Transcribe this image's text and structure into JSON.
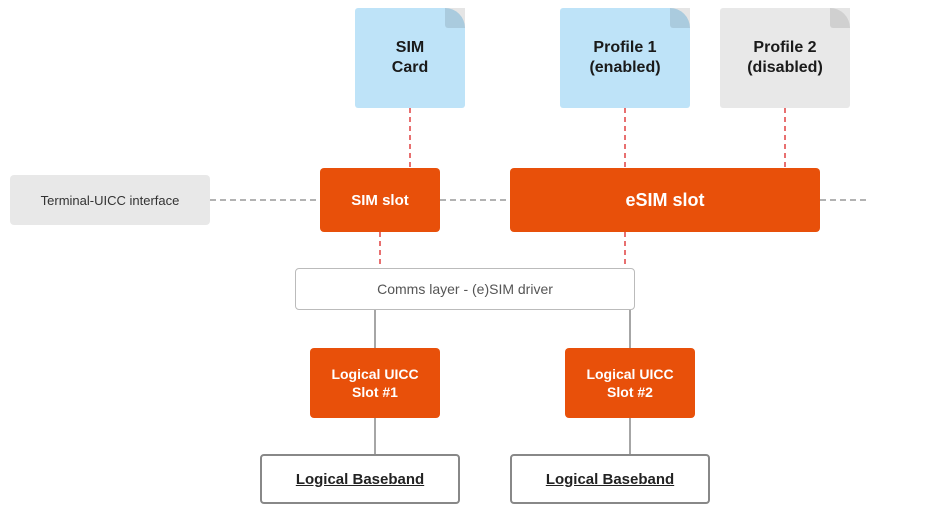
{
  "cards": {
    "sim": {
      "label": "SIM\nCard",
      "bg": "#bee3f8"
    },
    "profile1": {
      "label": "Profile 1\n(enabled)",
      "bg": "#bee3f8"
    },
    "profile2": {
      "label": "Profile 2\n(disabled)",
      "bg": "#e8e8e8"
    }
  },
  "terminal": {
    "label": "Terminal-UICC interface"
  },
  "slots": {
    "sim": "SIM slot",
    "esim": "eSIM slot"
  },
  "comms": {
    "label": "Comms layer - (e)SIM driver"
  },
  "luicc": {
    "slot1": "Logical UICC\nSlot #1",
    "slot2": "Logical UICC\nSlot #2"
  },
  "baseband": {
    "label1": "Logical  Baseband",
    "label2": "Logical  Baseband"
  }
}
